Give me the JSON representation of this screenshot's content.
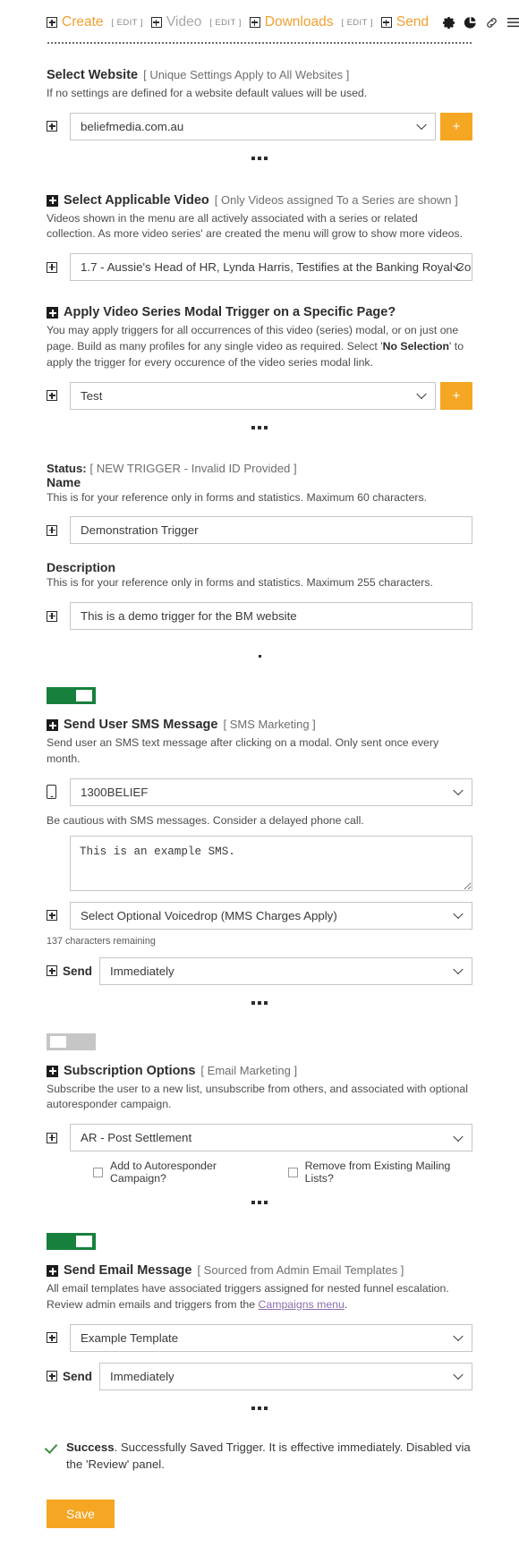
{
  "topnav": {
    "items": [
      {
        "label": "Create",
        "edit": "EDIT",
        "has_edit": true,
        "muted": false,
        "icon": "plus-square-icon"
      },
      {
        "label": "Video",
        "edit": "EDIT",
        "has_edit": true,
        "muted": true,
        "icon": "plus-square-icon"
      },
      {
        "label": "Downloads",
        "edit": "EDIT",
        "has_edit": true,
        "muted": false,
        "icon": "plus-square-icon"
      },
      {
        "label": "Send",
        "edit": "",
        "has_edit": false,
        "muted": false,
        "icon": "plus-square-icon"
      }
    ],
    "tools": [
      "gear-icon",
      "pie-chart-icon",
      "link-icon",
      "hamburger-menu-icon"
    ]
  },
  "website": {
    "title": "Select Website",
    "subtitle": "[ Unique Settings Apply to All Websites ]",
    "description": "If no settings are defined for a website default values will be used.",
    "select_value": "beliefmedia.com.au",
    "add_label": "+"
  },
  "video": {
    "title": "Select Applicable Video",
    "subtitle": "[ Only Videos assigned To a Series are shown ]",
    "description": "Videos shown in the menu are all actively associated with a series or related collection. As more video series' are created the menu will grow to show more videos.",
    "select_value": "1.7 - Aussie's Head of HR, Lynda Harris, Testifies at the Banking Royal Co"
  },
  "page_trigger": {
    "title": "Apply Video Series Modal Trigger on a Specific Page?",
    "description_1": "You may apply triggers for all occurrences of this video (series) modal, or on just one page. Build as many profiles for any single video as required. Select '",
    "description_bold": "No Selection",
    "description_2": "' to apply the trigger for every occurence of the video series modal link.",
    "select_value": "Test",
    "add_label": "+"
  },
  "status": {
    "label": "Status:",
    "value": "[ NEW TRIGGER - Invalid ID Provided ]",
    "name_label": "Name",
    "name_help": "This is for your reference only in forms and statistics. Maximum 60 characters.",
    "name_value": "Demonstration Trigger",
    "description_label": "Description",
    "description_help": "This is for your reference only in forms and statistics. Maximum 255 characters.",
    "description_value": "This is a demo trigger for the BM website"
  },
  "sms": {
    "toggle_state": "on",
    "title": "Send User SMS Message",
    "subtitle": "[ SMS Marketing ]",
    "description": "Send user an SMS text message after clicking on a modal. Only sent once every month.",
    "sender_value": "1300BELIEF",
    "caution": "Be cautious with SMS messages. Consider a delayed phone call.",
    "message_value": "This is an example SMS.",
    "voicedrop_value": "Select Optional Voicedrop (MMS Charges Apply)",
    "characters_remaining": "137 characters remaining",
    "send_label": "Send",
    "send_value": "Immediately"
  },
  "subscription": {
    "toggle_state": "off",
    "title": "Subscription Options",
    "subtitle": "[ Email Marketing ]",
    "description": "Subscribe the user to a new list, unsubscribe from others, and associated with optional autoresponder campaign.",
    "list_value": "AR - Post Settlement",
    "checkbox_1": "Add to Autoresponder Campaign?",
    "checkbox_2": "Remove from Existing Mailing Lists?"
  },
  "email": {
    "toggle_state": "on",
    "title": "Send Email Message",
    "subtitle": "[ Sourced from Admin Email Templates ]",
    "description_1": "All email templates have associated triggers assigned for nested funnel escalation. Review admin emails and triggers from the ",
    "link_text": "Campaigns menu",
    "description_2": ".",
    "template_value": "Example Template",
    "send_label": "Send",
    "send_value": "Immediately"
  },
  "success": {
    "bold": "Success",
    "text": ". Successfully Saved Trigger. It is effective immediately. Disabled via the 'Review' panel."
  },
  "footer": {
    "save_label": "Save"
  },
  "colors": {
    "accent_orange": "#f5a623",
    "toggle_on_green": "#17803d",
    "toggle_off_grey": "#c6c6c6",
    "link_purple": "#8a6fae",
    "success_green": "#3f8f46"
  }
}
